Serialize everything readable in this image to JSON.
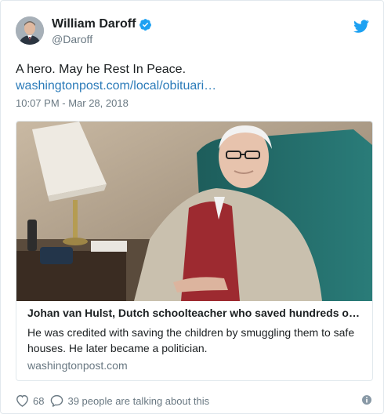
{
  "author": {
    "name": "William Daroff",
    "handle": "@Daroff",
    "avatar": "avatar",
    "verified_icon": "verified-badge-icon"
  },
  "tweet": {
    "text": "A hero. May he Rest In Peace.",
    "link": "washingtonpost.com/local/obituari…",
    "timestamp": "10:07 PM - Mar 28, 2018"
  },
  "card": {
    "image": "photo of an elderly man in a teal armchair",
    "title": "Johan van Hulst, Dutch schoolteacher who saved hundreds o…",
    "description": "He was credited with saving the children by smuggling them to safe houses. He later became a politician.",
    "domain": "washingtonpost.com"
  },
  "actions": {
    "likes": "68",
    "talking": "39 people are talking about this",
    "like_icon": "heart-icon",
    "reply_icon": "speech-bubble-icon",
    "info_icon": "info-icon"
  },
  "colors": {
    "link": "#2b7bb9",
    "twitter_blue": "#1da1f2",
    "secondary_text": "#697882",
    "border": "#e1e8ed"
  }
}
